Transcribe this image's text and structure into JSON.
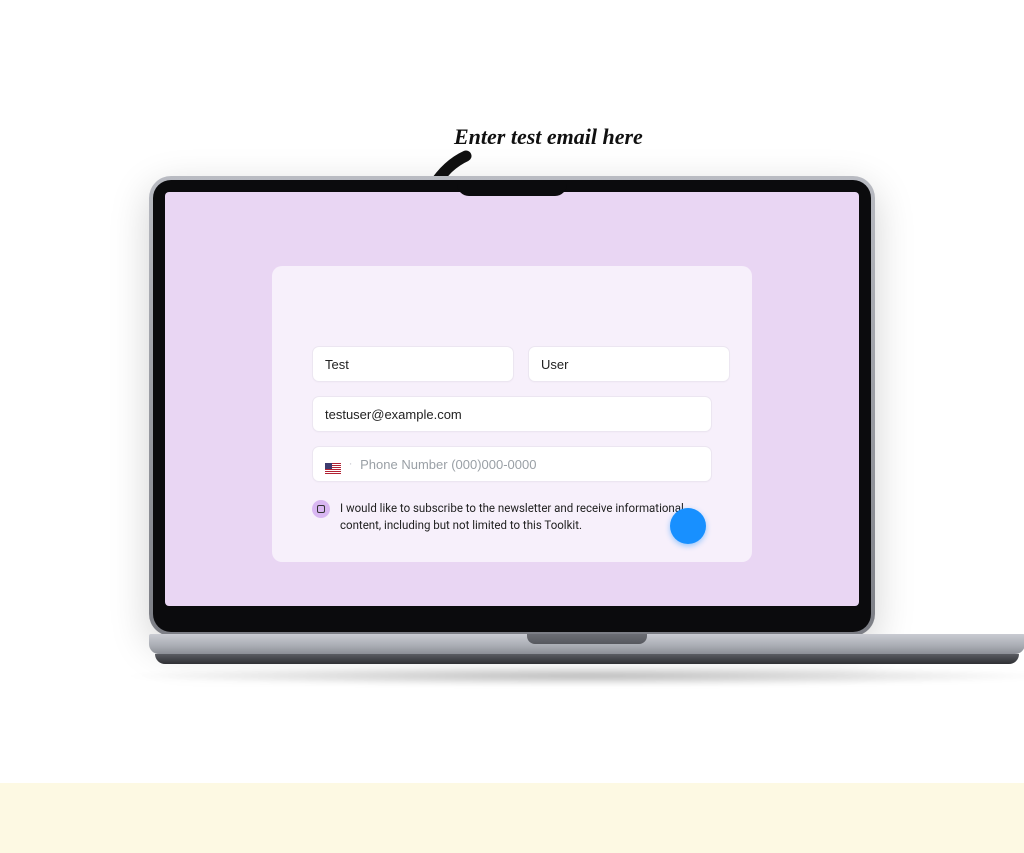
{
  "annotation": {
    "callout": "Enter test email here"
  },
  "form": {
    "first_name_value": "Test",
    "last_name_value": "User",
    "email_value": "testuser@example.com",
    "phone_placeholder": "Phone Number (000)000-0000",
    "consent_text": "I would like to subscribe to the newsletter and receive informational content, including but not limited to this Toolkit.",
    "country_icon": "us-flag-icon"
  },
  "colors": {
    "screen_bg": "#e9d6f3",
    "card_bg": "#f7f0fb",
    "submit": "#1890ff",
    "checkbox_bg": "#d9b7f2"
  }
}
